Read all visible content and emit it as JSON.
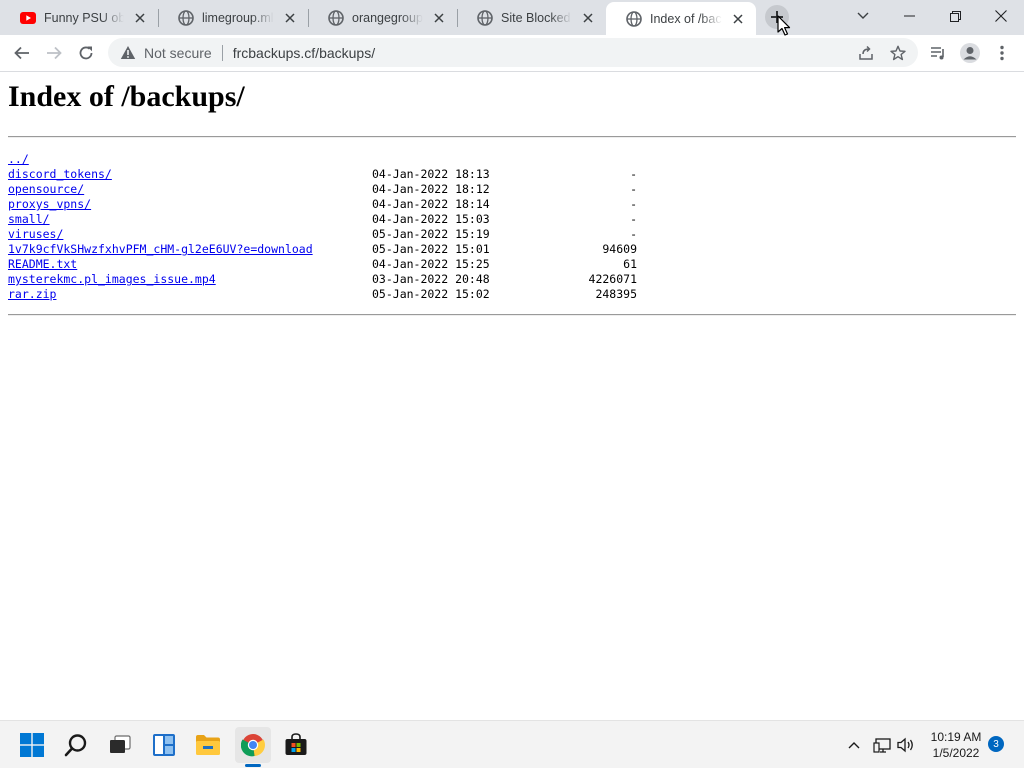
{
  "browser": {
    "tabs": [
      {
        "title": "Funny PSU obfuscation",
        "favicon": "youtube-icon",
        "active": false
      },
      {
        "title": "limegroup.ml",
        "favicon": "globe-icon",
        "active": false
      },
      {
        "title": "orangegroup.ml",
        "favicon": "globe-icon",
        "active": false
      },
      {
        "title": "Site Blocked",
        "favicon": "globe-icon",
        "active": false
      },
      {
        "title": "Index of /backups/",
        "favicon": "globe-icon",
        "active": true
      }
    ],
    "security_label": "Not secure",
    "url": "frcbackups.cf/backups/",
    "colors": {
      "tabstrip": "#dee1e6",
      "omnibox": "#f1f3f4",
      "link": "#0000ee"
    }
  },
  "page": {
    "heading": "Index of /backups/",
    "parent_link": "../",
    "entries": [
      {
        "name": "discord_tokens/",
        "date": "04-Jan-2022 18:13",
        "size": "-"
      },
      {
        "name": "opensource/",
        "date": "04-Jan-2022 18:12",
        "size": "-"
      },
      {
        "name": "proxys_vpns/",
        "date": "04-Jan-2022 18:14",
        "size": "-"
      },
      {
        "name": "small/",
        "date": "04-Jan-2022 15:03",
        "size": "-"
      },
      {
        "name": "viruses/",
        "date": "05-Jan-2022 15:19",
        "size": "-"
      },
      {
        "name": "1v7k9cfVkSHwzfxhvPFM_cHM-gl2eE6UV?e=download",
        "date": "05-Jan-2022 15:01",
        "size": "94609"
      },
      {
        "name": "README.txt",
        "date": "04-Jan-2022 15:25",
        "size": "61"
      },
      {
        "name": "mysterekmc.pl_images_issue.mp4",
        "date": "03-Jan-2022 20:48",
        "size": "4226071"
      },
      {
        "name": "rar.zip",
        "date": "05-Jan-2022 15:02",
        "size": "248395"
      }
    ]
  },
  "taskbar": {
    "apps": [
      "start-icon",
      "search-icon",
      "task-view-icon",
      "widgets-icon",
      "file-explorer-icon",
      "chrome-icon",
      "store-icon"
    ],
    "time": "10:19 AM",
    "date": "1/5/2022",
    "notification_count": "3",
    "accent": "#0067c0"
  }
}
